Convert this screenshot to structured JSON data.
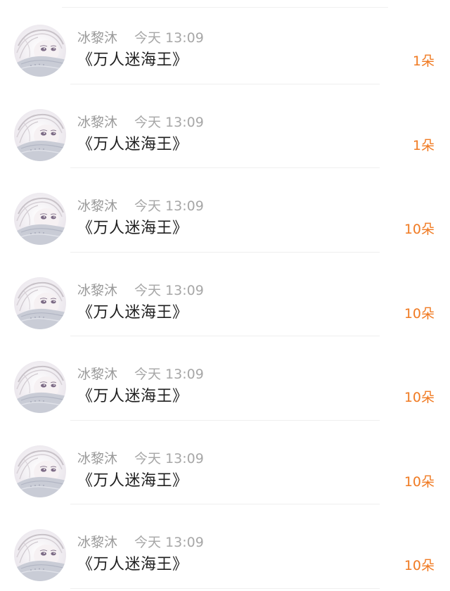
{
  "items": [
    {
      "name": "冰黎沐",
      "time": "今天 13:09",
      "title": "《万人迷海王》",
      "flower_label": "1朵"
    },
    {
      "name": "冰黎沐",
      "time": "今天 13:09",
      "title": "《万人迷海王》",
      "flower_label": "1朵"
    },
    {
      "name": "冰黎沐",
      "time": "今天 13:09",
      "title": "《万人迷海王》",
      "flower_label": "10朵"
    },
    {
      "name": "冰黎沐",
      "time": "今天 13:09",
      "title": "《万人迷海王》",
      "flower_label": "10朵"
    },
    {
      "name": "冰黎沐",
      "time": "今天 13:09",
      "title": "《万人迷海王》",
      "flower_label": "10朵"
    },
    {
      "name": "冰黎沐",
      "time": "今天 13:09",
      "title": "《万人迷海王》",
      "flower_label": "10朵"
    },
    {
      "name": "冰黎沐",
      "time": "今天 13:09",
      "title": "《万人迷海王》",
      "flower_label": "10朵"
    }
  ],
  "colors": {
    "accent": "#f07a22",
    "name_text": "#9a9a9a",
    "time_text": "#a7a7a7",
    "title_text": "#1f1f1f",
    "divider": "#efefef"
  }
}
